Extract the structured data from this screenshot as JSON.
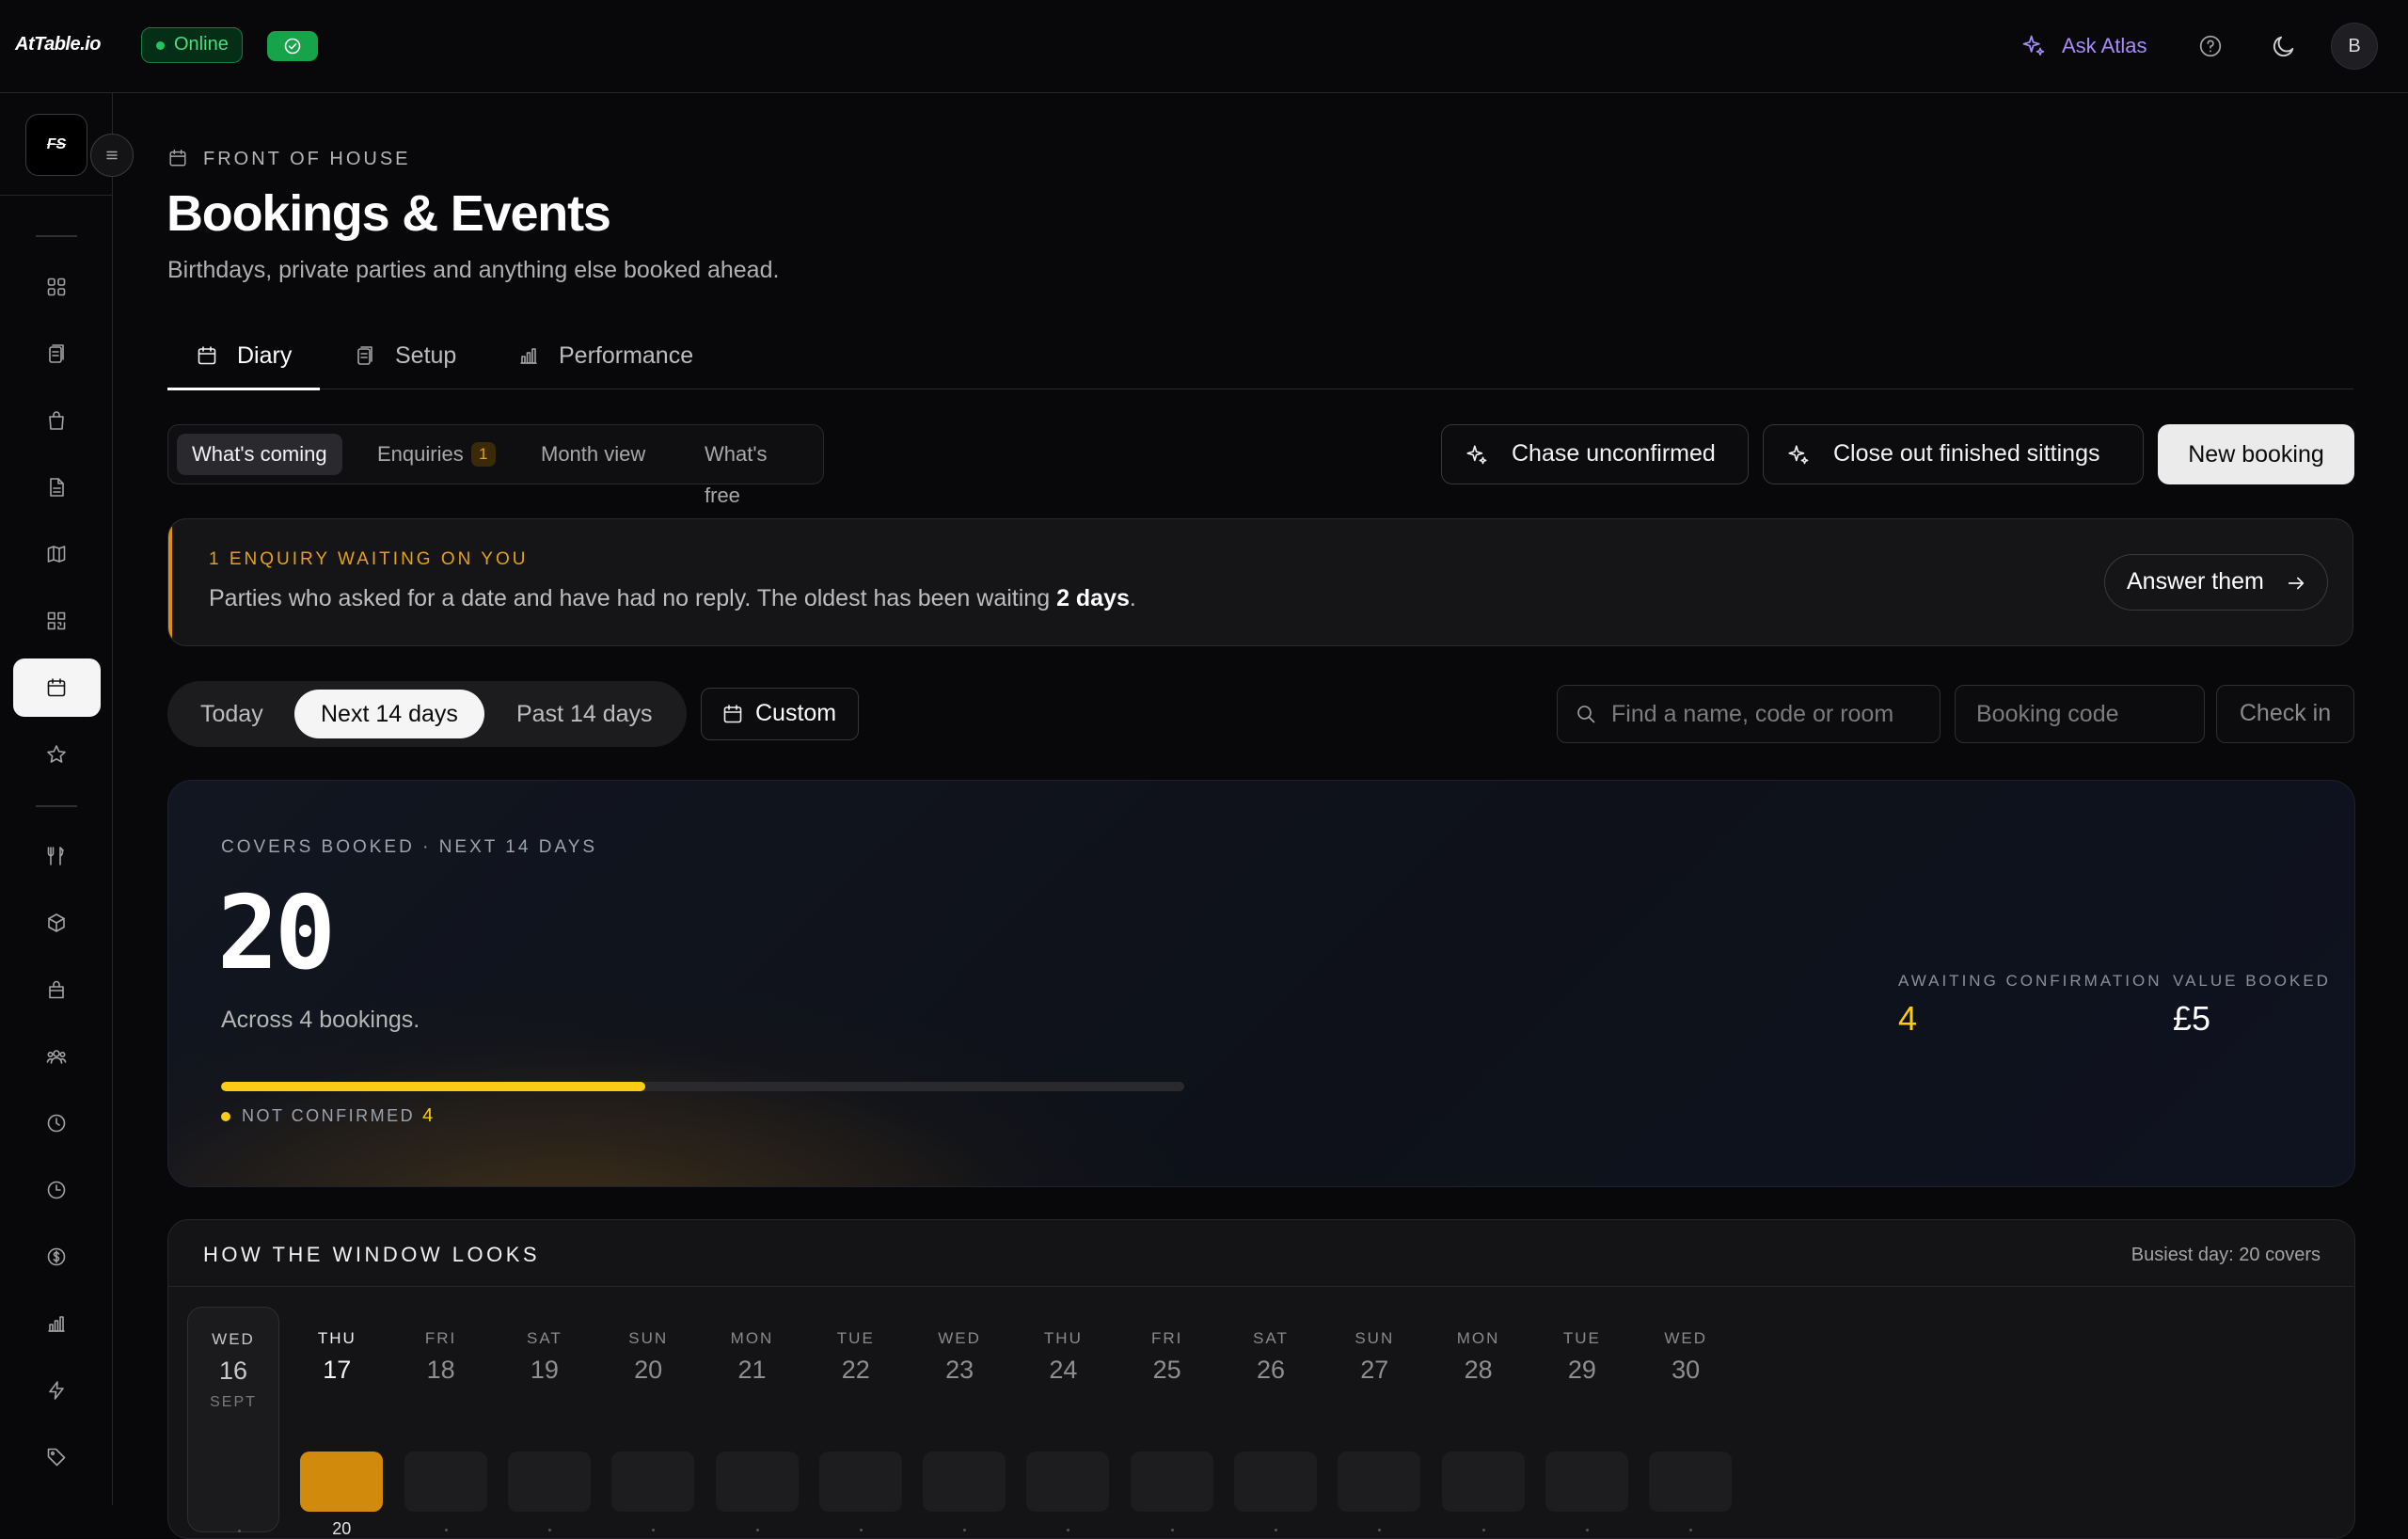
{
  "topbar": {
    "logo": "AtTable.io",
    "status": "Online",
    "ask_label": "Ask Atlas",
    "avatar_initial": "B"
  },
  "sidebar": {
    "brand": "FS",
    "items": [
      {
        "icon": "grid-icon"
      },
      {
        "icon": "clipboard-icon"
      },
      {
        "icon": "shopping-bag-icon"
      },
      {
        "icon": "document-icon"
      },
      {
        "icon": "map-icon"
      },
      {
        "icon": "qr-code-icon"
      },
      {
        "icon": "calendar-icon",
        "active": true
      },
      {
        "icon": "star-icon"
      },
      {
        "icon": "utensils-icon"
      },
      {
        "icon": "box-icon"
      },
      {
        "icon": "bag-icon"
      },
      {
        "icon": "users-icon"
      },
      {
        "icon": "clock-icon"
      },
      {
        "icon": "history-icon"
      },
      {
        "icon": "dollar-icon"
      },
      {
        "icon": "bar-chart-icon"
      },
      {
        "icon": "lightning-icon"
      },
      {
        "icon": "tag-icon"
      }
    ]
  },
  "page": {
    "eyebrow": "FRONT OF HOUSE",
    "title": "Bookings & Events",
    "subtitle": "Birthdays, private parties and anything else booked ahead."
  },
  "tabs": [
    {
      "label": "Diary",
      "active": true
    },
    {
      "label": "Setup"
    },
    {
      "label": "Performance"
    }
  ],
  "segments": {
    "whats_coming": "What's coming",
    "enquiries": "Enquiries",
    "enquiries_count": "1",
    "month_view": "Month view",
    "whats_free": "What's free"
  },
  "actions": {
    "chase": "Chase unconfirmed",
    "close_out": "Close out finished sittings",
    "new_booking": "New booking"
  },
  "alert": {
    "title": "1 ENQUIRY WAITING ON YOU",
    "text_before": "Parties who asked for a date and have had no reply. The oldest has been waiting ",
    "text_strong": "2 days",
    "text_after": ".",
    "button": "Answer them"
  },
  "range": {
    "today": "Today",
    "next": "Next 14 days",
    "past": "Past 14 days",
    "custom": "Custom"
  },
  "search": {
    "placeholder": "Find a name, code or room",
    "code_placeholder": "Booking code",
    "checkin": "Check in"
  },
  "hero": {
    "eyebrow": "COVERS BOOKED · NEXT 14 DAYS",
    "covers": "20",
    "subtitle": "Across 4 bookings.",
    "not_confirmed_fraction": 0.44,
    "legend_label": "NOT CONFIRMED",
    "legend_value": "4",
    "awaiting_label": "AWAITING CONFIRMATION",
    "awaiting_value": "4",
    "value_label": "VALUE BOOKED",
    "value_value": "£5",
    "colors": {
      "accent": "#facc15",
      "warning": "#e6a11b"
    }
  },
  "window": {
    "title": "HOW THE WINDOW LOOKS",
    "busiest": "Busiest day: 20 covers",
    "days": [
      {
        "dow": "WED",
        "num": "16",
        "month": "SEPT",
        "today": true,
        "count": ""
      },
      {
        "dow": "THU",
        "num": "17",
        "selected": true,
        "covers": 20,
        "count": "20"
      },
      {
        "dow": "FRI",
        "num": "18",
        "count": ""
      },
      {
        "dow": "SAT",
        "num": "19",
        "count": ""
      },
      {
        "dow": "SUN",
        "num": "20",
        "count": ""
      },
      {
        "dow": "MON",
        "num": "21",
        "count": ""
      },
      {
        "dow": "TUE",
        "num": "22",
        "count": ""
      },
      {
        "dow": "WED",
        "num": "23",
        "count": ""
      },
      {
        "dow": "THU",
        "num": "24",
        "count": ""
      },
      {
        "dow": "FRI",
        "num": "25",
        "count": ""
      },
      {
        "dow": "SAT",
        "num": "26",
        "count": ""
      },
      {
        "dow": "SUN",
        "num": "27",
        "count": ""
      },
      {
        "dow": "MON",
        "num": "28",
        "count": ""
      },
      {
        "dow": "TUE",
        "num": "29",
        "count": ""
      },
      {
        "dow": "WED",
        "num": "30",
        "count": ""
      }
    ]
  }
}
